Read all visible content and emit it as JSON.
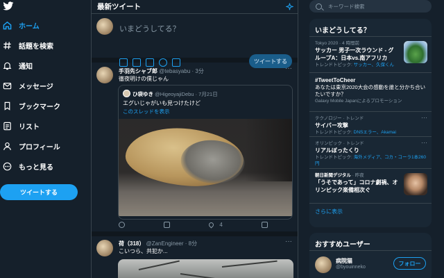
{
  "colors": {
    "background": "#15202b",
    "accent": "#1da1f2",
    "border": "#38444d",
    "panel": "#192734",
    "muted": "#8899a6"
  },
  "nav": {
    "logo_icon": "twitter-bird-icon",
    "items": [
      {
        "label": "ホーム",
        "icon": "home-icon",
        "active": true
      },
      {
        "label": "話題を検索",
        "icon": "hashtag-icon"
      },
      {
        "label": "通知",
        "icon": "bell-icon"
      },
      {
        "label": "メッセージ",
        "icon": "mail-icon"
      },
      {
        "label": "ブックマーク",
        "icon": "bookmark-icon"
      },
      {
        "label": "リスト",
        "icon": "list-icon"
      },
      {
        "label": "プロフィール",
        "icon": "person-icon"
      },
      {
        "label": "もっと見る",
        "icon": "more-circle-icon"
      }
    ],
    "tweet_button": "ツイートする"
  },
  "timeline": {
    "title": "最新ツイート",
    "compose": {
      "placeholder": "いまどうしてる？",
      "submit": "ツイートする"
    },
    "tweets": [
      {
        "name": "手羽先シャブ郎",
        "handle": "@tebasyabu",
        "time": "· 3分",
        "text": "徹夜明けの僕じゃん",
        "quote": {
          "name": "ひ袋ゆき",
          "handle": "@HigeoyajiDebu",
          "time": "· 7月21日",
          "text": "エグいじゃがいも見つけたけど",
          "link": "このスレッドを表示"
        },
        "likes": "4"
      },
      {
        "name": "荷（318）",
        "handle": "@ZanEngineer",
        "time": "· 8分",
        "text": "こいつら、共犯か..."
      }
    ]
  },
  "sidebar": {
    "search_placeholder": "キーワード検索",
    "trends_title": "いまどうしてる？",
    "trends": [
      {
        "context": "Tokyo 2020 · 4 時間前",
        "title": "サッカー 男子一次ラウンド - グループA：日本vs.南アフリカ",
        "sub_prefix": "トレンドトピック: ",
        "sub_links": "サッカー、久保くん"
      },
      {
        "title": "#TweetToCheer",
        "desc": "あなたは東京2020大会の感動を誰と分かち合いたいですか？",
        "sub_prefix": "Galaxy Mobile Japanによるプロモーション"
      },
      {
        "context": "テクノロジー · トレンド",
        "title": "サイバー攻撃",
        "sub_prefix": "トレンドトピック: ",
        "sub_links": "DNSエラー、Akamai"
      },
      {
        "context": "オリンピック · トレンド",
        "title": "リアルぼったくり",
        "sub_prefix": "トレンドトピック: ",
        "sub_links": "海外メディア、コカ・コーラ1本260円"
      },
      {
        "source": "朝日新聞デジタル",
        "time": "· 昨夜",
        "title": "「うそであって」コロナ劇禍、オリンピック楽備相次ぐ"
      }
    ],
    "show_more": "さらに表示",
    "who_to_follow_title": "おすすめユーザー",
    "follow": {
      "name": "病院猫",
      "handle": "@byouinneko",
      "button": "フォロー"
    }
  }
}
